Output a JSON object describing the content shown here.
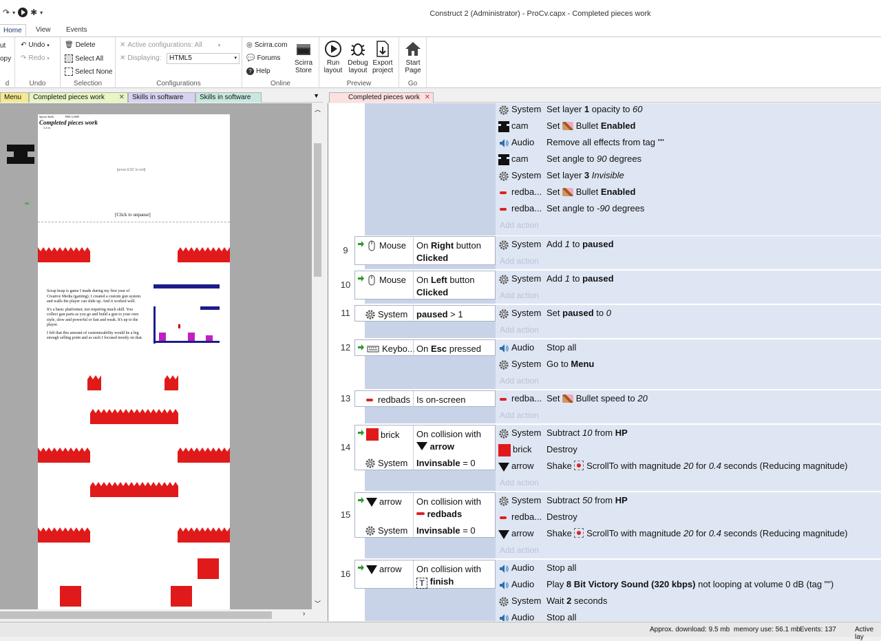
{
  "window": {
    "title": "Construct 2 (Administrator) - ProCv.capx - Completed pieces work"
  },
  "ribbon_tabs": [
    "Home",
    "View",
    "Events"
  ],
  "ribbon": {
    "clipboard": {
      "cut": "ut",
      "copy": "opy",
      "label": "d"
    },
    "undo": {
      "undo": "Undo",
      "redo": "Redo",
      "label": "Undo"
    },
    "selection": {
      "delete": "Delete",
      "select_all": "Select All",
      "select_none": "Select None",
      "label": "Selection"
    },
    "configurations": {
      "active": "Active configurations: All",
      "displaying_label": "Displaying:",
      "displaying_value": "HTML5",
      "label": "Configurations"
    },
    "online": {
      "scirra": "Scirra.com",
      "forums": "Forums",
      "help": "Help",
      "store_line1": "Scirra",
      "store_line2": "Store",
      "label": "Online"
    },
    "preview": {
      "run_line1": "Run",
      "run_line2": "layout",
      "debug_line1": "Debug",
      "debug_line2": "layout",
      "export_line1": "Export",
      "export_line2": "project",
      "label": "Preview"
    },
    "go": {
      "start_line1": "Start",
      "start_line2": "Page",
      "label": "Go"
    }
  },
  "left_tabs": [
    "Menu",
    "Completed pieces work",
    "Skills in software",
    "Skills in software"
  ],
  "right_tabs": [
    "Completed pieces work"
  ],
  "layout_page": {
    "header_left": "Sprites Skills",
    "header_right": "PRE GAME",
    "title": "Completed pieces work",
    "sub": "1.5 m",
    "press_esc": "[press ESC to exit]",
    "click_unpause": "[Click to unpause]",
    "para1": "Scrap heap is game I made during my first year of Creative Media (gaming). I created a custom gun system and walls the player can slide up. And it worked well.",
    "para2": "It's a basic platformer, not requiring much skill. You collect gun parts as you go and build a gun to your own style, slow and powerful or fast and weak. It's up to the player.",
    "para3": "I felt that this amount of customizability would be a big enough selling point and as such I focused mostly on that."
  },
  "event_sheet": {
    "top_actions": [
      {
        "obj": "System",
        "icon": "gear-icon",
        "html": "Set layer <b>1</b> opacity to <i>60</i>"
      },
      {
        "obj": "cam",
        "icon": "cam-icon",
        "html": "Set <span class='bul'></span> Bullet <b>Enabled</b>"
      },
      {
        "obj": "Audio",
        "icon": "speaker-icon",
        "html": "Remove all effects from tag \"\""
      },
      {
        "obj": "cam",
        "icon": "cam-icon",
        "html": "Set angle to <i>90</i> degrees"
      },
      {
        "obj": "System",
        "icon": "gear-icon",
        "html": "Set layer <b>3</b> <i>Invisible</i>"
      },
      {
        "obj": "redba...",
        "icon": "redbads-icon",
        "html": "Set <span class='bul'></span> Bullet <b>Enabled</b>"
      },
      {
        "obj": "redba...",
        "icon": "redbads-icon",
        "html": "Set angle to <i>-90</i> degrees"
      }
    ],
    "add_action": "Add action",
    "events": [
      {
        "num": "9",
        "conds": [
          {
            "obj": "Mouse",
            "icon": "mouse-icon",
            "trigger": true,
            "html": "On <b>Right</b> button<br><b>Clicked</b>"
          }
        ],
        "actions": [
          {
            "obj": "System",
            "icon": "gear-icon",
            "html": "Add <i>1</i> to <b>paused</b>"
          }
        ]
      },
      {
        "num": "10",
        "conds": [
          {
            "obj": "Mouse",
            "icon": "mouse-icon",
            "trigger": true,
            "html": "On <b>Left</b> button<br><b>Clicked</b>"
          }
        ],
        "actions": [
          {
            "obj": "System",
            "icon": "gear-icon",
            "html": "Add <i>1</i> to <b>paused</b>"
          }
        ]
      },
      {
        "num": "11",
        "conds": [
          {
            "obj": "System",
            "icon": "gear-icon",
            "trigger": false,
            "html": "<b>paused</b> &gt; 1"
          }
        ],
        "actions": [
          {
            "obj": "System",
            "icon": "gear-icon",
            "html": "Set <b>paused</b> to <i>0</i>"
          }
        ]
      },
      {
        "num": "12",
        "conds": [
          {
            "obj": "Keybo...",
            "icon": "keyboard-icon",
            "trigger": true,
            "html": "On <b>Esc</b> pressed"
          }
        ],
        "actions": [
          {
            "obj": "Audio",
            "icon": "speaker-icon",
            "html": "Stop all"
          },
          {
            "obj": "System",
            "icon": "gear-icon",
            "html": "Go to <b>Menu</b>"
          }
        ]
      },
      {
        "num": "13",
        "conds": [
          {
            "obj": "redbads",
            "icon": "redbads-icon",
            "trigger": false,
            "html": "Is on-screen"
          }
        ],
        "actions": [
          {
            "obj": "redba...",
            "icon": "redbads-icon",
            "html": "Set <span class='bul'></span> Bullet speed to <i>20</i>"
          }
        ]
      },
      {
        "num": "14",
        "conds": [
          {
            "obj": "brick",
            "icon": "brick-icon",
            "trigger": true,
            "html": "On collision with<br><span class='arr'></span> <b>arrow</b>"
          },
          {
            "obj": "System",
            "icon": "gear-icon",
            "trigger": false,
            "html": "<b>Invinsable</b> = 0"
          }
        ],
        "actions": [
          {
            "obj": "System",
            "icon": "gear-icon",
            "html": "Subtract <i>10</i> from <b>HP</b>"
          },
          {
            "obj": "brick",
            "icon": "brick-icon",
            "html": "Destroy"
          },
          {
            "obj": "arrow",
            "icon": "arrow-icon",
            "html": "Shake <span class='scr'></span> ScrollTo with magnitude <i>20</i> for <i>0.4</i> seconds (Reducing magnitude)"
          }
        ]
      },
      {
        "num": "15",
        "conds": [
          {
            "obj": "arrow",
            "icon": "arrow-icon",
            "trigger": true,
            "html": "On collision with<br><span class='red'></span> <b>redbads</b>"
          },
          {
            "obj": "System",
            "icon": "gear-icon",
            "trigger": false,
            "html": "<b>Invinsable</b> = 0"
          }
        ],
        "actions": [
          {
            "obj": "System",
            "icon": "gear-icon",
            "html": "Subtract <i>50</i> from <b>HP</b>"
          },
          {
            "obj": "redba...",
            "icon": "redbads-icon",
            "html": "Destroy"
          },
          {
            "obj": "arrow",
            "icon": "arrow-icon",
            "html": "Shake <span class='scr'></span> ScrollTo with magnitude <i>20</i> for <i>0.4</i> seconds (Reducing magnitude)"
          }
        ]
      },
      {
        "num": "16",
        "conds": [
          {
            "obj": "arrow",
            "icon": "arrow-icon",
            "trigger": true,
            "html": "On collision with<br><span class='tt'>T</span> <b>finish</b>"
          }
        ],
        "actions": [
          {
            "obj": "Audio",
            "icon": "speaker-icon",
            "html": "Stop all"
          },
          {
            "obj": "Audio",
            "icon": "speaker-icon",
            "html": "Play <b>8 Bit Victory Sound (320  kbps)</b> not looping at volume 0 dB (tag \"\")"
          },
          {
            "obj": "System",
            "icon": "gear-icon",
            "html": "Wait <b>2</b> seconds"
          },
          {
            "obj": "Audio",
            "icon": "speaker-icon",
            "html": "Stop all"
          }
        ]
      }
    ]
  },
  "status": {
    "download": "Approx. download: 9.5 mb",
    "memory": "memory use: 56.1 mb",
    "events": "Events: 137",
    "active": "Active lay"
  }
}
